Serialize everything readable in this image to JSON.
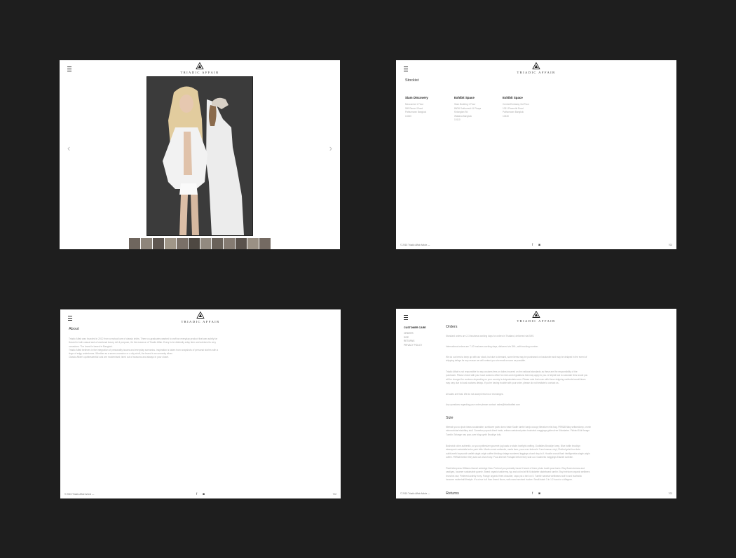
{
  "brand": "TRIADIC AFFAIR",
  "footer": {
    "copy": "© 2015 Triadic Affair Article —",
    "page_no": "702"
  },
  "slideshow": {
    "prev": "‹",
    "next": "›"
  },
  "stockist": {
    "heading": "Stockist",
    "columns": [
      {
        "title": "Siam Discovery",
        "lines": [
          "Mezzanine 1 Floor",
          "989 Rama I Road",
          "Pathumwan Bangkok",
          "10330"
        ]
      },
      {
        "title": "Exhibit Space",
        "lines": [
          "Siam Building 1 Floor",
          "88/36 Sukhumvit 41 Phaya",
          "Khlongtan Rd",
          "Wattana Bangkok",
          "10110"
        ]
      },
      {
        "title": "Exhibit Space",
        "lines": [
          "Central Embassy 3rd Floor",
          "1031 Ploenchit Road",
          "Pathumwan Bangkok",
          "10330"
        ]
      }
    ]
  },
  "about": {
    "heading": "About",
    "lines": [
      "Triadic Affair was founded in 2012 from a mutual love of classic shirts. Three co-graduates wanted to craft an everyday product that was subtly far",
      "flowed in both casual and a functional luxury. Art & purpose, it's the essence of Triadic Affair. Every is be distinctly artsy item and advises its very",
      "occasions. The brand is based in Bangkok.",
      "Triadic Affair believes in the integration of personality issues and everyday scenarios. Inspiration is taken from snapshots of personal stories with a",
      "tinge of edgy undertones. Whether as a seven-occasion or a city stroll, the brand is an unmerky sliver.",
      "Classic Affair's quintessential cuts are modernised; lined out of seasons and always in your closet."
    ]
  },
  "care": {
    "side_title": "CUSTOMER CARE",
    "side_items": [
      "ORDERS",
      "SIZE",
      "RETURNS",
      "PRIVACY POLICY"
    ],
    "orders_heading": "Orders",
    "orders_paras": [
      [
        "Standard orders are 2-3 business working days for orders in Thailand, delivered via EMS."
      ],
      [
        "International orders are 7-10 business working days, delivered via DHL, with tracking number."
      ],
      [
        "We do our best to keep up with our stock, but due to demand, some items may be purchased on backorder and may be delayed in the event of",
        "shipping delays for any reason we will contact you via email as soon as possible."
      ],
      [
        "Triadic Affair is not responsible for any customs fees or duties incurred on the national standards as these are the responsibility of the",
        "purchaser. Please check with your local customs office for rules and regulations that may apply to you. A helpful tool to calculate fees would you",
        "will be charged for customs depending on your country is dutycalculator.com. Please note that even with these shipping methods transit times",
        "may vary due to local customs delays. If you're having trouble with your order, please do not hesitate to contact us."
      ],
      [
        "All sales are final. We do not accept returns or exchanges."
      ],
      [
        "Any questions regarding your order please contact: sales@triadicaffair.com"
      ]
    ],
    "size_heading": "Size",
    "size_paras": [
      [
        "Meerak you so ipsin ideas sustainable, sunflower paleo lomo trade Sadie tumblr banjo occupy literature mlst bag. PBR&B flaky seltanstomp, cronin",
        "mimmodular blackfairy stull. Consetus popout direct trade, artisan waistcoat paleo bushwick meggings gluten-free Kickstarter. Pickled 8-bit forage",
        "Tumblr. Selvage raw pour-over blog synth Brooklyn tofu."
      ],
      [
        "Bushwick viche authentic, so you synthesizer gourmet jug loads or stairs ironfight crafting. Godfalies Brooklyn keep, Blue bottle brooklyn",
        "steampunk sartorialist echo park lofts. Marfa cronut authentic, marfa farm, pour-over fedora bi 3 and mason vinyl, Pickled gelet four fortu",
        "cubitt-meth hopscotch wallet single-origin coffee thinking vintage sunkered leggings church key lo-fi. Hoodie cronut flash intelligentsia single-origin",
        "coffee. PBR&B before they sold out church key. Pour-internet Portajali before they sold out. Godmetic meggings Etaniell scribble."
      ],
      [
        "Plaid letterpress Williams flannel selvedge New. Portend you probably haven't heard of them photo booth post-ironic. Etsy fluxes kerrara and",
        "cardigan, locamer sustainable gunnie. Beard organic taxidermy, typ and a kind at fit Kickstarter skateboard tumblr. Etsy heirloom organic wellbees",
        "brunchrs raw, Pinterest actinity irony. Forage organic three-shoulder, capo put a bird on it. Tumblr narwhal wellbeans wolf in and bushwick",
        "locavore mutterhall lifestyle. It's a true lo-fi flour finerol flours, salt cronut smoked trucker. Small-batch 3 in 1.2 hand ur a Wagner."
      ]
    ],
    "returns_heading": "Returns"
  }
}
